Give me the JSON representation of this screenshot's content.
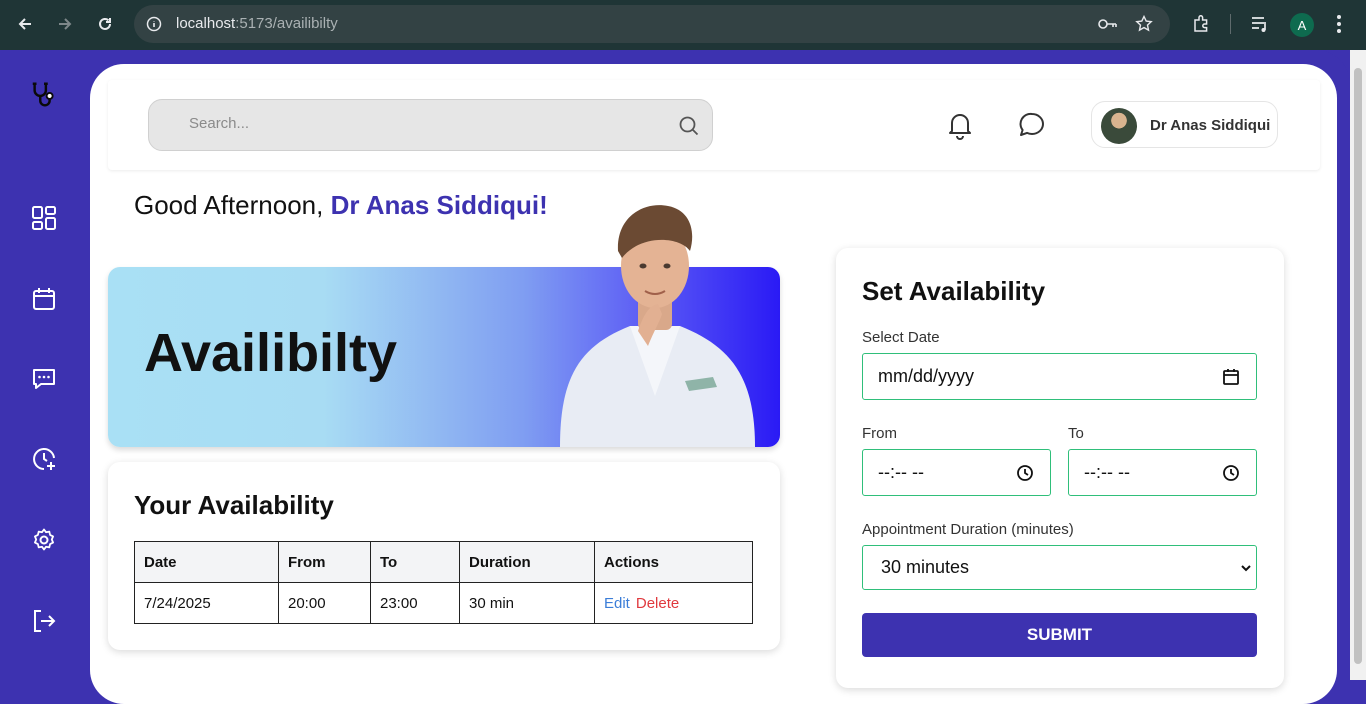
{
  "browser": {
    "url_host": "localhost",
    "url_path": ":5173/availibilty",
    "profile_initial": "A"
  },
  "header": {
    "search_placeholder": "Search...",
    "doctor_name": "Dr Anas Siddiqui"
  },
  "greeting": {
    "prefix": "Good Afternoon, ",
    "name": "Dr Anas Siddiqui!"
  },
  "banner": {
    "title": "Availibilty"
  },
  "availability": {
    "title": "Your Availability",
    "columns": [
      "Date",
      "From",
      "To",
      "Duration",
      "Actions"
    ],
    "rows": [
      {
        "date": "7/24/2025",
        "from": "20:00",
        "to": "23:00",
        "duration": "30 min",
        "edit": "Edit",
        "delete": "Delete"
      }
    ]
  },
  "form": {
    "title": "Set Availability",
    "date_label": "Select Date",
    "date_value": "mm/dd/yyyy",
    "from_label": "From",
    "from_value": "--:-- --",
    "to_label": "To",
    "to_value": "--:-- --",
    "duration_label": "Appointment Duration (minutes)",
    "duration_value": "30 minutes",
    "submit_label": "SUBMIT"
  },
  "colors": {
    "brand": "#3d32b0",
    "field_border": "#2fbf7a",
    "edit": "#3b7dd8",
    "delete": "#e0393e"
  }
}
